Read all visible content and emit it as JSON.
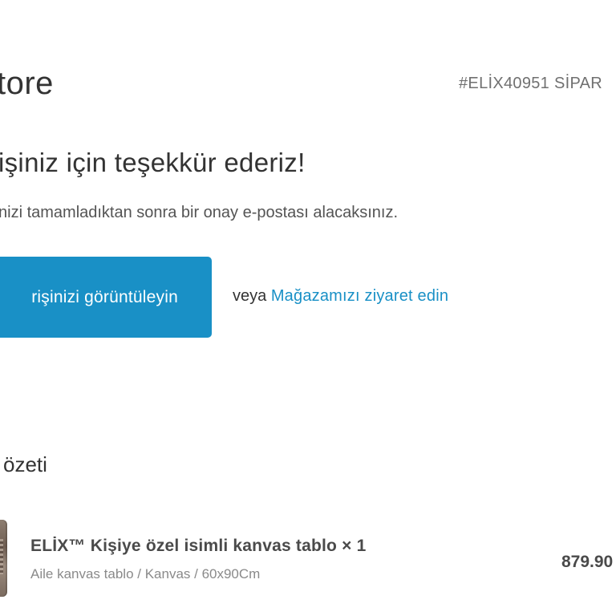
{
  "header": {
    "store_name": "tore",
    "order_number": "#ELİX40951 SİPAR"
  },
  "thank_you": {
    "heading": "işiniz için teşekkür ederiz!",
    "confirmation_text": "nizi tamamladıktan sonra bir onay e-postası alacaksınız."
  },
  "actions": {
    "view_order_label": "rişinizi görüntüleyin",
    "or_label": "veya",
    "visit_store_label": "Mağazamızı ziyaret edin",
    "button_color": "#1990c6",
    "link_color": "#1990c6"
  },
  "summary": {
    "heading": "özeti",
    "items": [
      {
        "title": "ELİX™ Kişiye özel isimli kanvas tablo × 1",
        "variant": "Aile kanvas tablo / Kanvas / 60x90Cm",
        "price": "879.90"
      }
    ]
  }
}
